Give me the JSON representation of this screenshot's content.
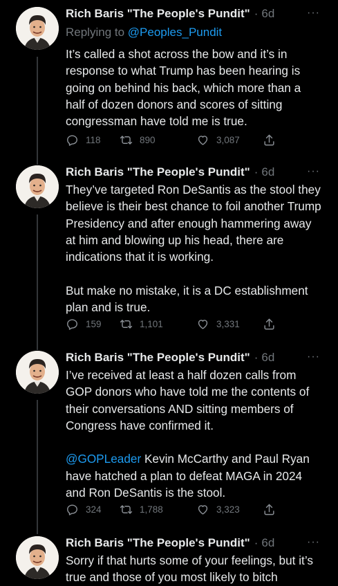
{
  "tweets": [
    {
      "author": "Rich Baris \"The People's Pundit\"",
      "time": "6d",
      "replying_prefix": "Replying to",
      "replying_handle": "@Peoples_Pundit",
      "text": "It’s called a shot across the bow and it’s in response to what Trump has been hearing is going on behind his back, which more than a half of dozen donors and scores of sitting congressman have told me is true.",
      "replies": "118",
      "retweets": "890",
      "likes": "3,087"
    },
    {
      "author": "Rich Baris \"The People's Pundit\"",
      "time": "6d",
      "text": "They’ve targeted Ron DeSantis as the stool they believe is their best chance to foil another Trump Presidency and after enough hammering away at him and blowing up his head, there are indications that it is working.\n\nBut make no mistake, it is a DC establishment plan and is true.",
      "replies": "159",
      "retweets": "1,101",
      "likes": "3,331"
    },
    {
      "author": "Rich Baris \"The People's Pundit\"",
      "time": "6d",
      "text_part1": "I’ve received at least a half dozen calls from GOP donors who have told me the contents of their conversations AND sitting members of Congress have confirmed it.\n\n",
      "mention": "@GOPLeader",
      "text_part2": " Kevin McCarthy and Paul Ryan have hatched a plan to defeat MAGA in 2024 and Ron DeSantis is the stool.",
      "replies": "324",
      "retweets": "1,788",
      "likes": "3,323"
    },
    {
      "author": "Rich Baris \"The People's Pundit\"",
      "time": "6d",
      "text": "Sorry if that hurts some of your feelings, but it’s true and those of you most likely to bitch"
    }
  ],
  "more_glyph": "···",
  "dot_glyph": "·",
  "icons": [
    "avatar",
    "more-icon",
    "reply-icon",
    "retweet-icon",
    "like-icon",
    "share-icon"
  ]
}
